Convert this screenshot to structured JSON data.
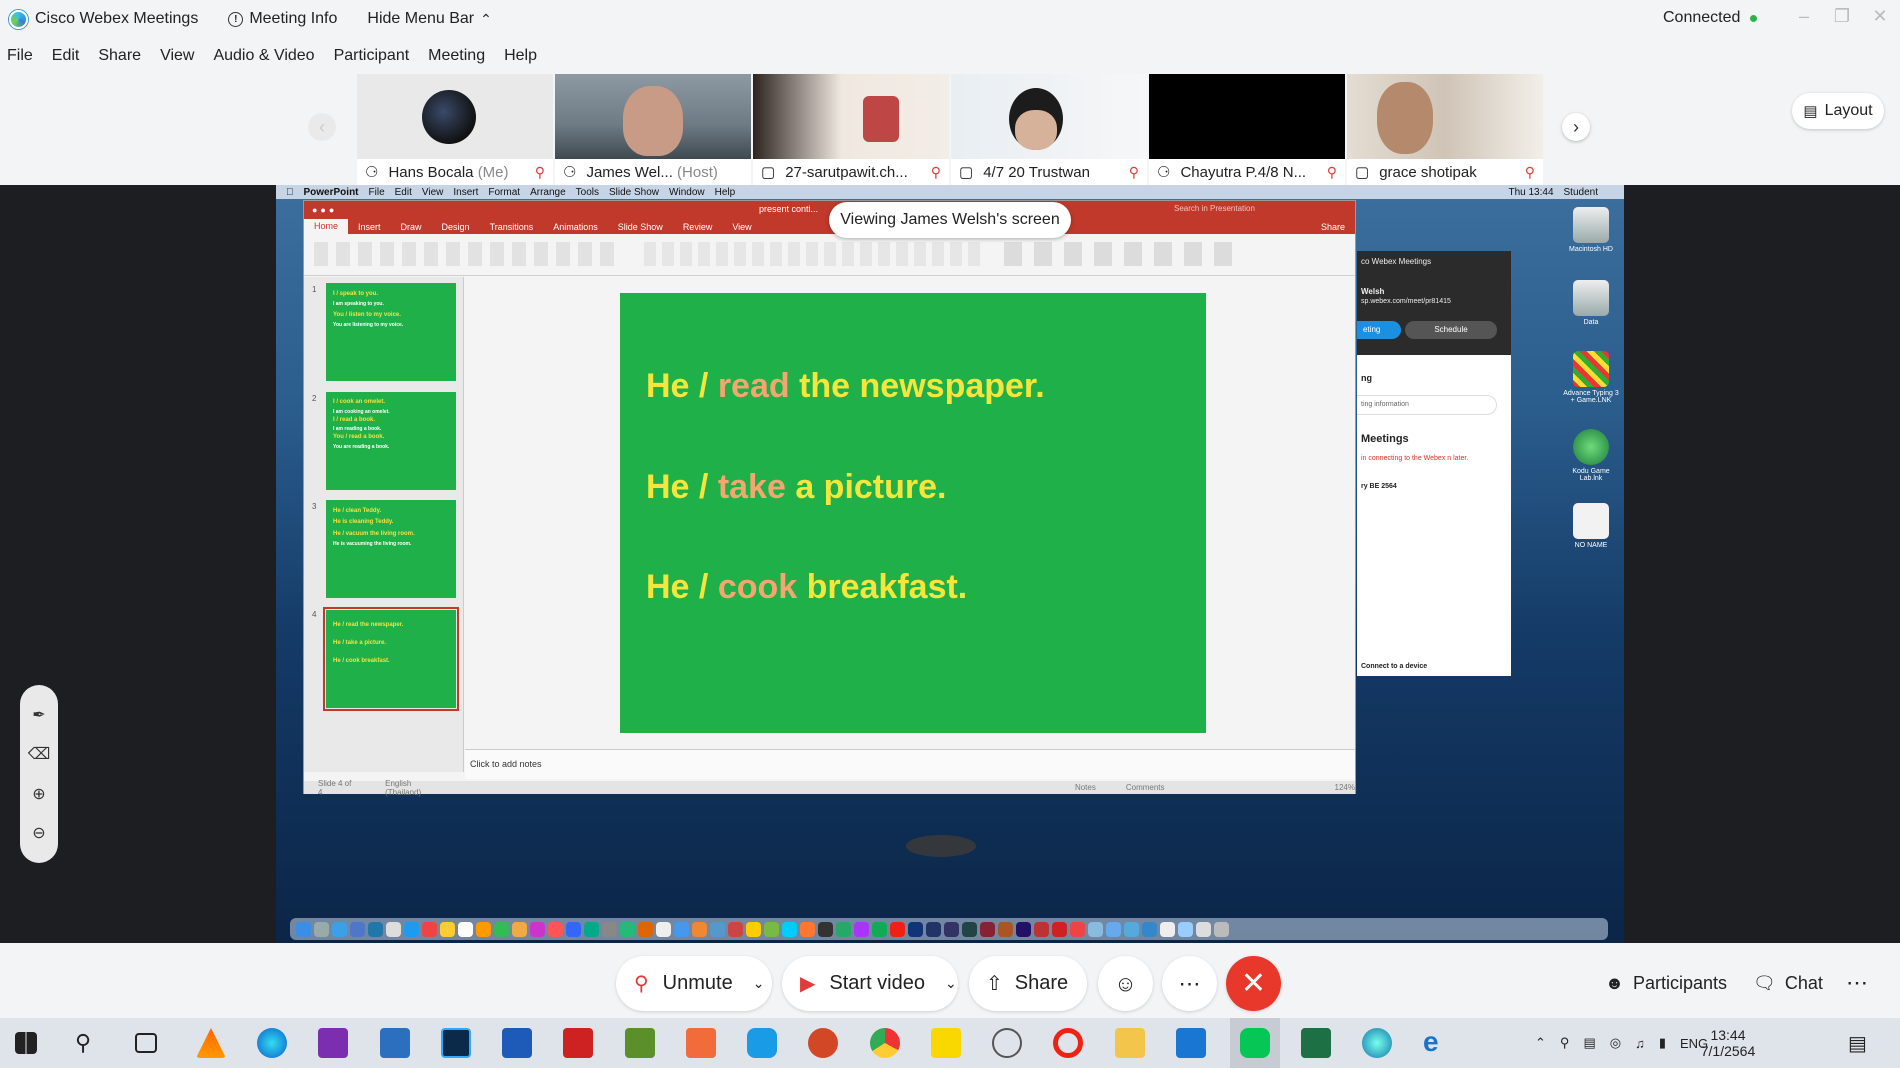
{
  "titlebar": {
    "app": "Cisco Webex Meetings",
    "meeting_info": "Meeting Info",
    "hide_menu": "Hide Menu Bar",
    "status": "Connected"
  },
  "menu": [
    "File",
    "Edit",
    "Share",
    "View",
    "Audio & Video",
    "Participant",
    "Meeting",
    "Help"
  ],
  "participants": [
    {
      "name": "Hans Bocala",
      "tag": "(Me)"
    },
    {
      "name": "James Wel...",
      "tag": "(Host)"
    },
    {
      "name": "27-sarutpawit.ch...",
      "tag": ""
    },
    {
      "name": "4/7 20 Trustwan",
      "tag": ""
    },
    {
      "name": "Chayutra P.4/8 N...",
      "tag": ""
    },
    {
      "name": "grace shotipak",
      "tag": ""
    }
  ],
  "layout_label": "Layout",
  "viewing_banner": "Viewing James Welsh's screen",
  "mac": {
    "menu": [
      "PowerPoint",
      "File",
      "Edit",
      "View",
      "Insert",
      "Format",
      "Arrange",
      "Tools",
      "Slide Show",
      "Window",
      "Help"
    ],
    "clock": "Thu 13:44",
    "user": "Student"
  },
  "ppt": {
    "tabs": [
      "Home",
      "Insert",
      "Draw",
      "Design",
      "Transitions",
      "Animations",
      "Slide Show",
      "Review",
      "View"
    ],
    "share": "Share",
    "search": "Search in Presentation",
    "doc_title": "present conti...",
    "thumbs": [
      {
        "num": "1",
        "lines": [
          "I / speak to you.",
          "I am speaking to you.",
          "You / listen to my voice.",
          "You are listening to my voice."
        ]
      },
      {
        "num": "2",
        "lines": [
          "I / cook an omelet.",
          "I am cooking an omelet.",
          "I / read a book.",
          "I am reading a book.",
          "You / read a book.",
          "You are reading a book."
        ]
      },
      {
        "num": "3",
        "lines": [
          "He / clean Teddy.",
          "He is cleaning Teddy.",
          "He / vacuum the living room.",
          "He is vacuuming the living room."
        ]
      },
      {
        "num": "4",
        "lines": [
          "He / read the newspaper.",
          "He / take a picture.",
          "He / cook breakfast."
        ]
      }
    ],
    "slide_lines": [
      {
        "pre": "He / ",
        "verb": "read",
        "post": " the newspaper."
      },
      {
        "pre": "He / ",
        "verb": "take",
        "post": " a picture."
      },
      {
        "pre": "He / ",
        "verb": "cook",
        "post": " breakfast."
      }
    ],
    "notes_placeholder": "Click to add notes",
    "status_slide": "Slide 4 of 4",
    "status_lang": "English (Thailand)",
    "status_notes": "Notes",
    "status_comments": "Comments",
    "zoom": "124%"
  },
  "webex_panel": {
    "title": "co Webex Meetings",
    "name": "Welsh",
    "url": "sp.webex.com/meet/pr81415",
    "btn_meeting": "eting",
    "btn_schedule": "Schedule",
    "section": "ng",
    "input": "ting information",
    "heading": "Meetings",
    "error": "in connecting to the Webex n later.",
    "date": "ry BE 2564",
    "connect": "Connect to a device"
  },
  "desktop_icons": [
    "Macintosh HD",
    "Data",
    "Advance Typing 3 + Game.LNK",
    "Kodu Game Lab.lnk",
    "NO NAME"
  ],
  "controls": {
    "unmute": "Unmute",
    "start_video": "Start video",
    "share": "Share",
    "participants": "Participants",
    "chat": "Chat"
  },
  "taskbar": {
    "lang": "ENG",
    "time": "13:44",
    "date": "7/1/2564"
  }
}
